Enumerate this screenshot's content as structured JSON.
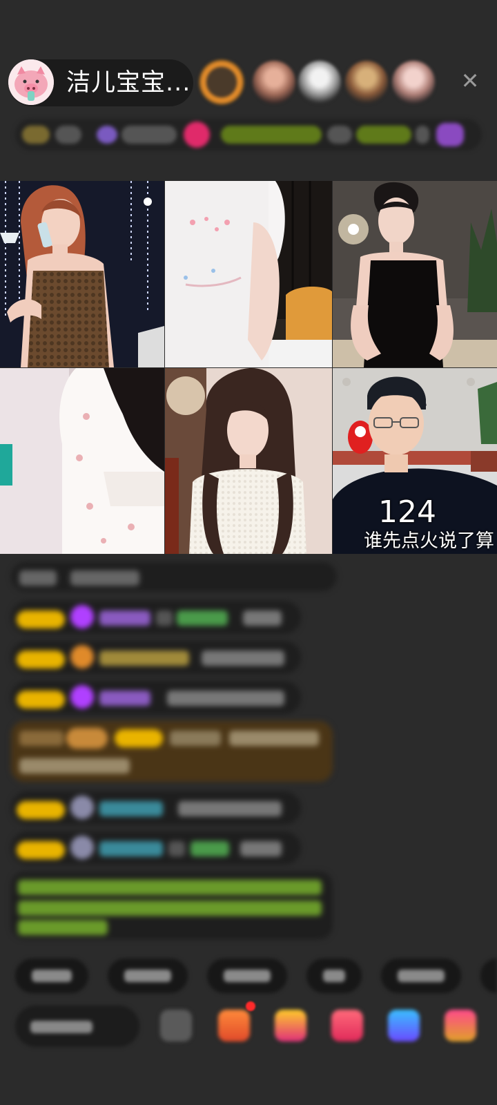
{
  "host": {
    "name": "洁儿宝宝...",
    "avatar_icon": "pink-pig-avatar-icon"
  },
  "top_bar": {
    "close_icon": "close-icon",
    "close_glyph": "✕"
  },
  "video_grid": {
    "score": "124",
    "caption": "谁先点火说了算"
  },
  "colors": {
    "background": "#2b2b2b",
    "badge": "#e9b400",
    "highlight_message": "#4a3516",
    "green_text": "#8bd03c"
  }
}
